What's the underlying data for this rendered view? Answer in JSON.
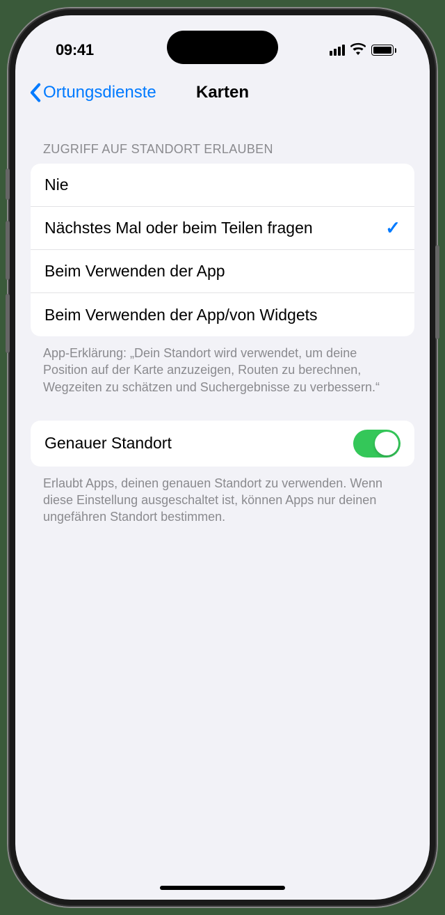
{
  "status_bar": {
    "time": "09:41"
  },
  "nav": {
    "back_label": "Ortungsdienste",
    "title": "Karten"
  },
  "location_access": {
    "header": "Zugriff auf Standort erlauben",
    "options": [
      {
        "label": "Nie",
        "selected": false
      },
      {
        "label": "Nächstes Mal oder beim Teilen fragen",
        "selected": true
      },
      {
        "label": "Beim Verwenden der App",
        "selected": false
      },
      {
        "label": "Beim Verwenden der App/von Widgets",
        "selected": false
      }
    ],
    "footer": "App-Erklärung: „Dein Standort wird verwendet, um deine Position auf der Karte anzuzeigen, Routen zu berechnen, Wegzeiten zu schätzen und Suchergebnisse zu verbessern.“"
  },
  "precise_location": {
    "label": "Genauer Standort",
    "enabled": true,
    "footer": "Erlaubt Apps, deinen genauen Standort zu verwenden. Wenn diese Einstellung ausgeschaltet ist, können Apps nur deinen ungefähren Standort bestimmen."
  }
}
